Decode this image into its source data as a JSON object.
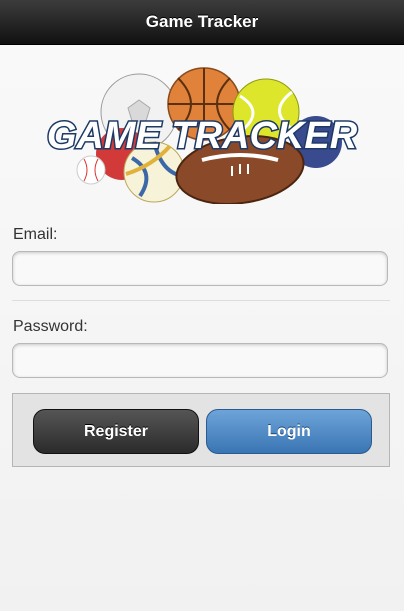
{
  "header": {
    "title": "Game Tracker"
  },
  "logo": {
    "text": "GAME TRACKER"
  },
  "form": {
    "email_label": "Email:",
    "email_value": "",
    "password_label": "Password:",
    "password_value": ""
  },
  "buttons": {
    "register_label": "Register",
    "login_label": "Login"
  },
  "colors": {
    "header": "#1a1a1a",
    "login": "#4a86c5",
    "register": "#333333"
  }
}
